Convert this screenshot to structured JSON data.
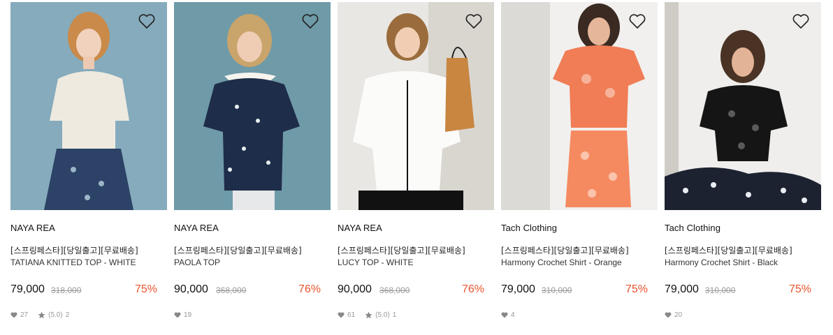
{
  "products": [
    {
      "brand": "NAYA REA",
      "promo": "[스프링페스타][당일출고][무료배송]",
      "name": "TATIANA KNITTED TOP - WHITE",
      "price": "79,000",
      "original_price": "318,000",
      "discount": "75%",
      "likes": "27",
      "rating": "(5.0)",
      "review_count": "2",
      "has_rating": true
    },
    {
      "brand": "NAYA REA",
      "promo": "[스프링페스타][당일출고][무료배송]",
      "name": "PAOLA TOP",
      "price": "90,000",
      "original_price": "368,000",
      "discount": "76%",
      "likes": "19",
      "has_rating": false
    },
    {
      "brand": "NAYA REA",
      "promo": "[스프링페스타][당일출고][무료배송]",
      "name": "LUCY TOP - WHITE",
      "price": "90,000",
      "original_price": "368,000",
      "discount": "76%",
      "likes": "61",
      "rating": "(5.0)",
      "review_count": "1",
      "has_rating": true
    },
    {
      "brand": "Tach Clothing",
      "promo": "[스프링페스타][당일출고][무료배송]",
      "name": "Harmony Crochet Shirt - Orange",
      "price": "79,000",
      "original_price": "310,000",
      "discount": "75%",
      "likes": "4",
      "has_rating": false
    },
    {
      "brand": "Tach Clothing",
      "promo": "[스프링페스타][당일출고][무료배송]",
      "name": "Harmony Crochet Shirt - Black",
      "price": "79,000",
      "original_price": "310,000",
      "discount": "75%",
      "likes": "20",
      "has_rating": false
    }
  ],
  "colors": {
    "discount": "#e8542d",
    "muted": "#999999",
    "text": "#111111"
  },
  "icons": {
    "wishlist": "heart-outline-icon",
    "likes": "heart-icon",
    "rating": "star-icon"
  }
}
